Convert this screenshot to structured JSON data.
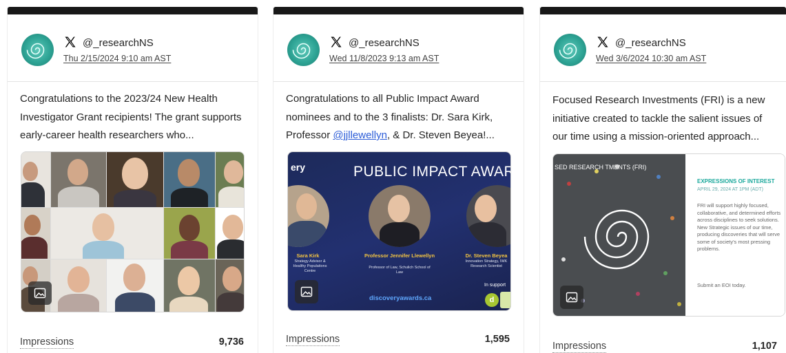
{
  "colors": {
    "accent_link": "#2a5bd7",
    "topbar": "#181818",
    "avatar_teal": "#2ea495"
  },
  "posts": [
    {
      "platform_icon": "x-logo-icon",
      "handle": "@_researchNS",
      "date": "Thu 2/15/2024 9:10 am AST",
      "text": "Congratulations to the 2023/24 New Health Investigator Grant recipients! The grant supports early-career health researchers who...",
      "impressions_label": "Impressions",
      "impressions_value": "9,736"
    },
    {
      "platform_icon": "x-logo-icon",
      "handle": "@_researchNS",
      "date": "Wed 11/8/2023 9:13 am AST",
      "text_before": "Congratulations to all Public Impact Award nominees and to the 3 finalists: Dr. Sara Kirk, Professor ",
      "text_mention": "@jjllewellyn",
      "text_after": ", & Dr. Steven Beyea!...",
      "impressions_label": "Impressions",
      "impressions_value": "1,595",
      "image": {
        "corner_text": "ery",
        "title": "PUBLIC IMPACT AWARD",
        "finalists": [
          {
            "name": "Sara Kirk",
            "sub": "Strategy Advisor & Healthy Populations Centre"
          },
          {
            "name": "Professor Jennifer Llewellyn",
            "sub": "Professor of Law, Schulich School of Law"
          },
          {
            "name": "Dr. Steven Beyea",
            "sub": "Innovation Strategy, IWK Research Scientist"
          }
        ],
        "site": "discoveryawards.ca",
        "support": "In support"
      }
    },
    {
      "platform_icon": "x-logo-icon",
      "handle": "@_researchNS",
      "date": "Wed 3/6/2024 10:30 am AST",
      "text": "Focused Research Investments (FRI) is a new initiative created to tackle the salient issues of our time using a mission-oriented approach...",
      "impressions_label": "Impressions",
      "impressions_value": "1,107",
      "image": {
        "corner_text": "SED RESEARCH TMENTS (FRI)",
        "heading": "EXPRESSIONS OF INTEREST",
        "date": "APRIL 29, 2024 AT 1PM (ADT)",
        "body": "FRI will support highly focused, collaborative, and determined efforts across disciplines to seek solutions. New Strategic issues of our time, producing discoveries that will serve some of society's most pressing problems.",
        "submit": "Submit an EOI today."
      }
    }
  ]
}
